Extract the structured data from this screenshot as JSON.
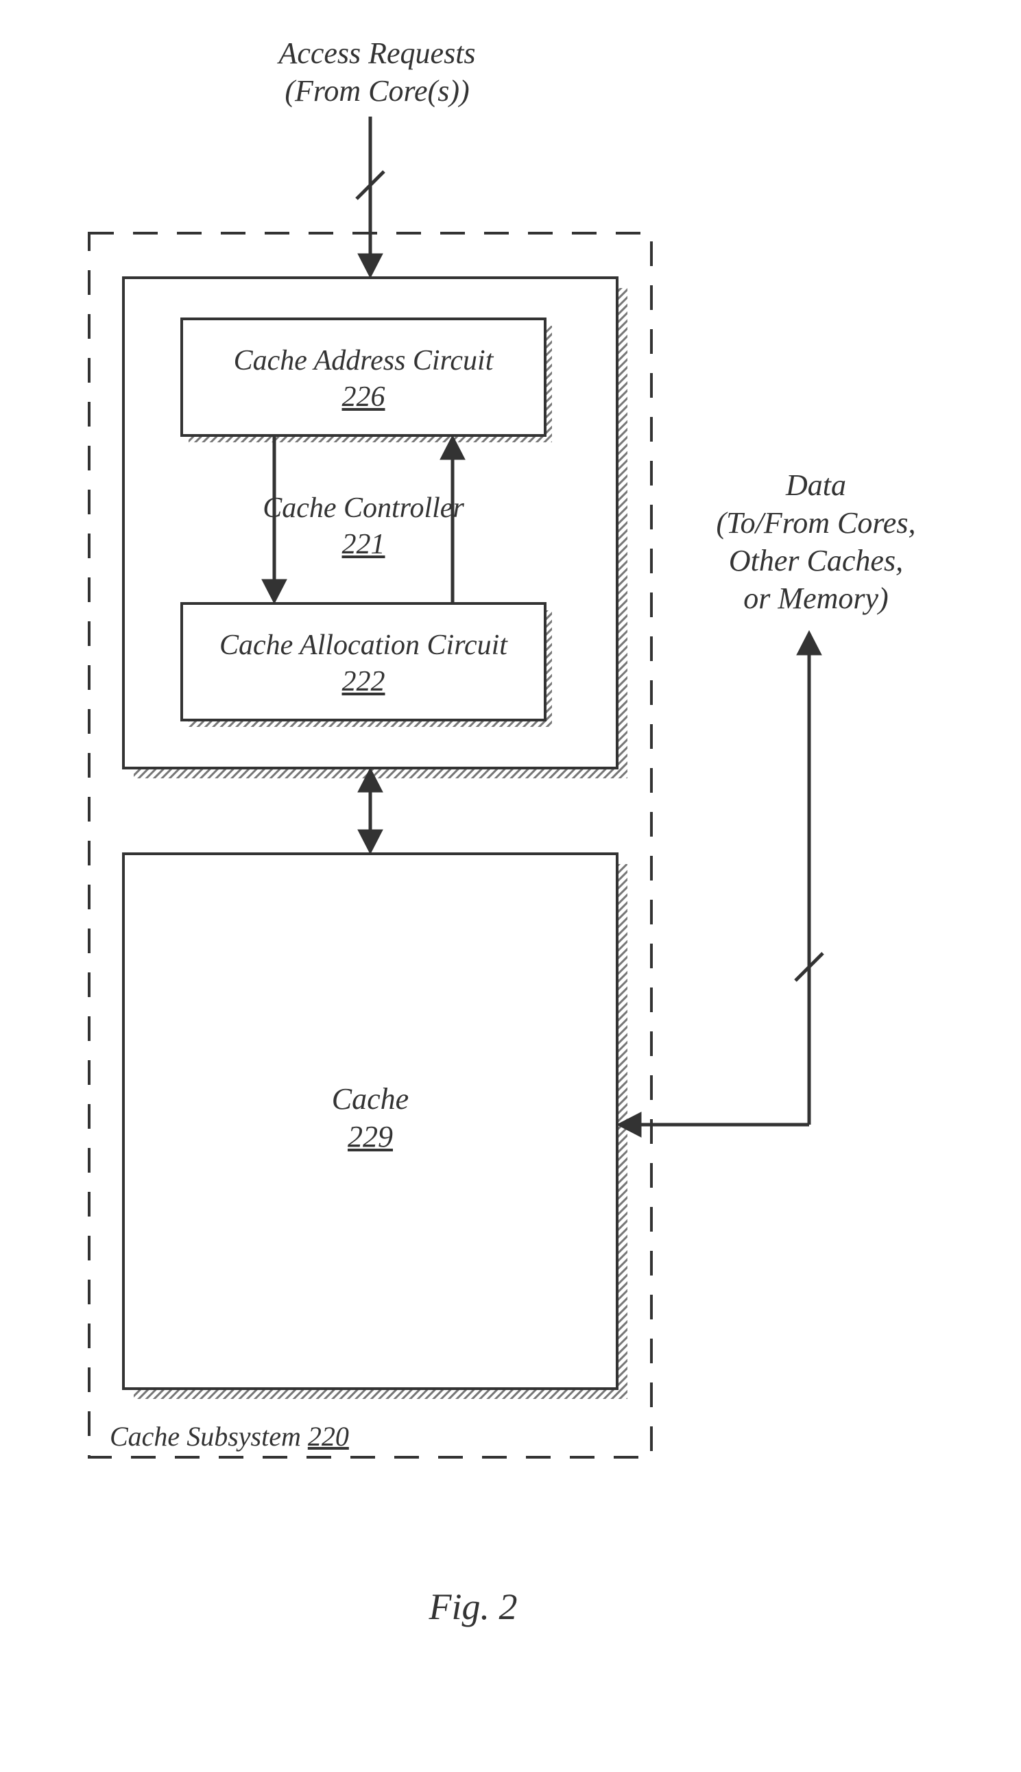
{
  "top_label_line1": "Access Requests",
  "top_label_line2": "(From Core(s))",
  "right_label_line1": "Data",
  "right_label_line2": "(To/From Cores,",
  "right_label_line3": "Other Caches,",
  "right_label_line4": "or Memory)",
  "subsystem_label": "Cache Subsystem",
  "subsystem_ref": "220",
  "controller_label": "Cache Controller",
  "controller_ref": "221",
  "addr_circuit_label": "Cache Address Circuit",
  "addr_circuit_ref": "226",
  "alloc_circuit_label": "Cache Allocation Circuit",
  "alloc_circuit_ref": "222",
  "cache_label": "Cache",
  "cache_ref": "229",
  "figure_label": "Fig. 2"
}
